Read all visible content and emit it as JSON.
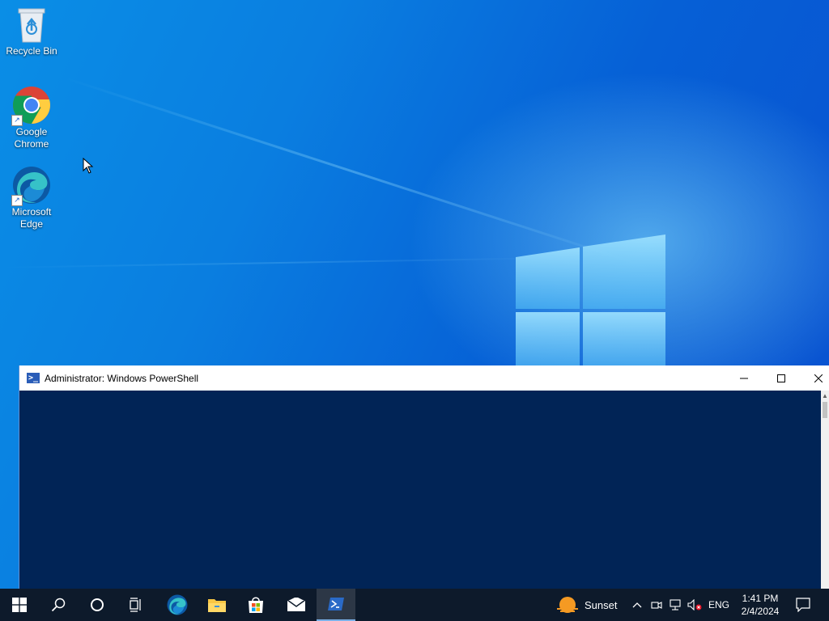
{
  "desktop": {
    "icons": [
      {
        "label": "Recycle Bin",
        "icon": "recycle-bin-icon"
      },
      {
        "label": "Google\nChrome",
        "icon": "chrome-icon"
      },
      {
        "label": "Microsoft\nEdge",
        "icon": "edge-icon"
      }
    ],
    "wallpaper_color": "#0a6fd8"
  },
  "powershell": {
    "title": "Administrator: Windows PowerShell",
    "background": "#012456",
    "minimize_symbol": "—",
    "maximize_symbol": "☐",
    "close_symbol": "✕"
  },
  "taskbar": {
    "items": [
      {
        "name": "start-button",
        "icon": "windows-icon"
      },
      {
        "name": "search-button",
        "icon": "search-icon"
      },
      {
        "name": "cortana-button",
        "icon": "circle-icon"
      },
      {
        "name": "task-view-button",
        "icon": "task-view-icon"
      },
      {
        "name": "edge-taskbar-button",
        "icon": "edge-icon"
      },
      {
        "name": "file-explorer-button",
        "icon": "folder-icon"
      },
      {
        "name": "store-button",
        "icon": "store-icon"
      },
      {
        "name": "mail-button",
        "icon": "mail-icon"
      },
      {
        "name": "powershell-taskbar-button",
        "icon": "powershell-icon",
        "active": true
      }
    ],
    "weather": {
      "label": "Sunset"
    },
    "language": "ENG",
    "time": "1:41 PM",
    "date": "2/4/2024"
  }
}
